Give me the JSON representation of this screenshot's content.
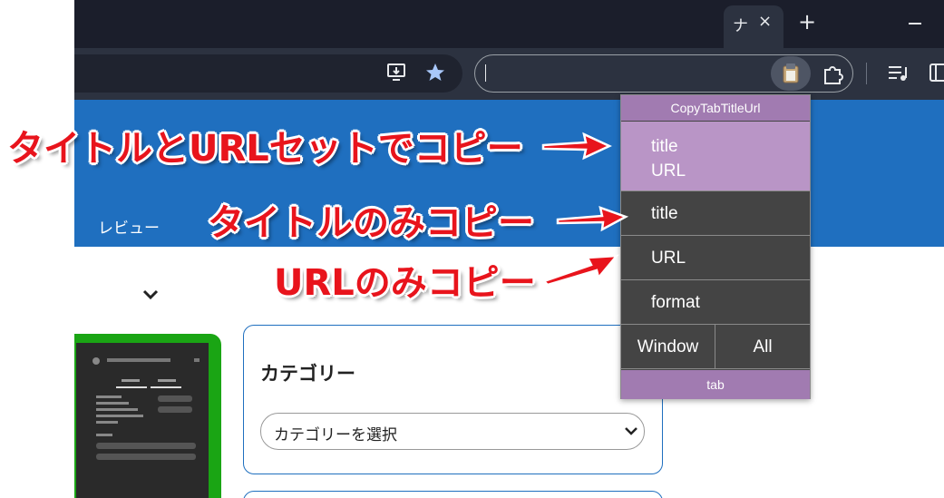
{
  "browser": {
    "tab_title": "ナ",
    "tab_close": "×",
    "new_tab": "+"
  },
  "page": {
    "nav_review": "レビュー",
    "category": {
      "title": "カテゴリー",
      "select_value": "カテゴリーを選択"
    }
  },
  "popup": {
    "header": "CopyTabTitleUrl",
    "items": [
      {
        "line1": "title",
        "line2": "URL"
      },
      {
        "label": "title"
      },
      {
        "label": "URL"
      },
      {
        "label": "format"
      }
    ],
    "buttons": [
      "Window",
      "All"
    ],
    "footer": "tab"
  },
  "annotations": [
    "タイトルとURLセットでコピー",
    "タイトルのみコピー",
    "URLのみコピー"
  ],
  "colors": {
    "annotation_red": "#e8141c",
    "popup_purple": "#a17bb1",
    "popup_highlight": "#b995c6",
    "header_blue": "#1f6fbf"
  }
}
